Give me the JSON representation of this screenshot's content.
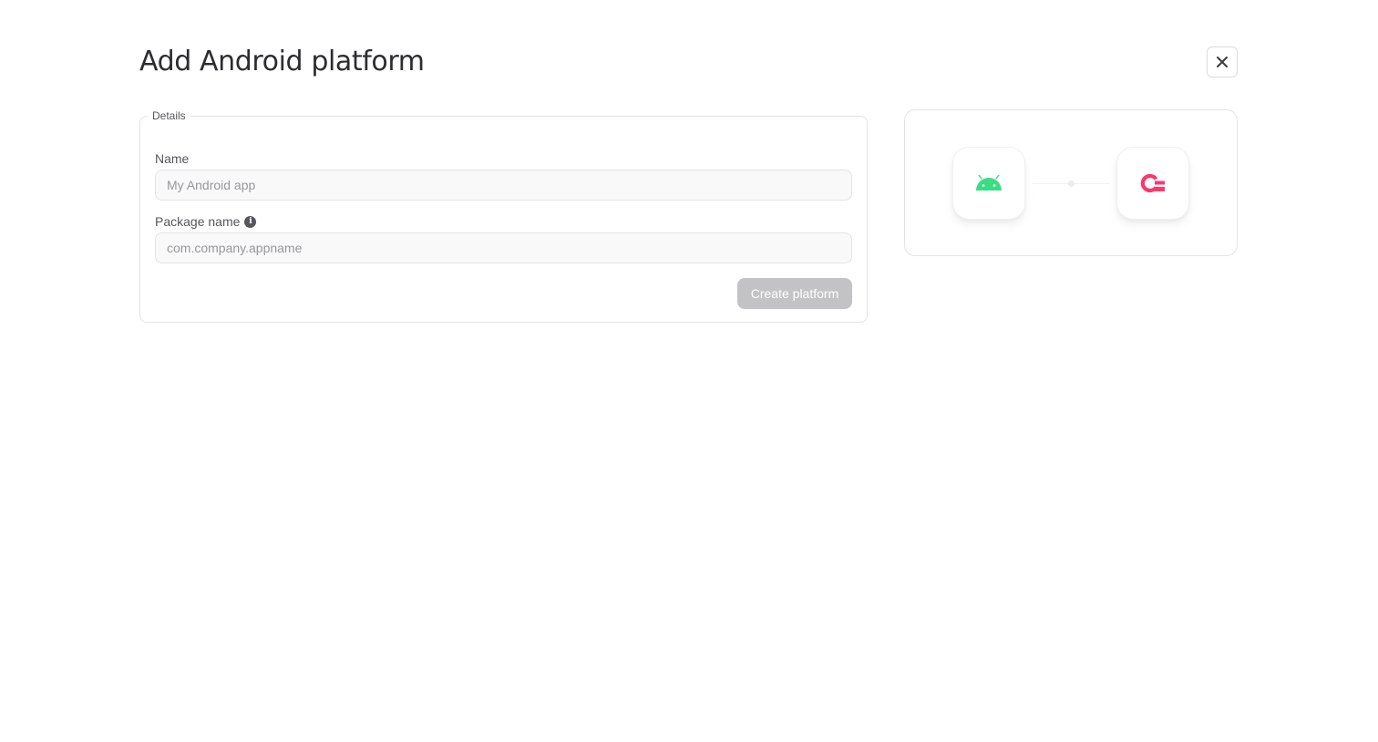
{
  "dialog": {
    "title": "Add Android platform",
    "close_icon": "close-icon"
  },
  "form": {
    "legend": "Details",
    "name_label": "Name",
    "name_placeholder": "My Android app",
    "name_value": "",
    "package_label": "Package name",
    "package_info_icon": "info-icon",
    "package_placeholder": "com.company.appname",
    "package_value": "",
    "submit_label": "Create platform",
    "submit_disabled": true
  },
  "illustration": {
    "left_icon": "android-icon",
    "right_icon": "appwrite-logo-icon",
    "colors": {
      "android_green": "#3ddc84",
      "appwrite_pink": "#fd366e"
    }
  },
  "colors": {
    "text_primary": "#2d2d31",
    "text_secondary": "#56565c",
    "border": "#e4e4e7",
    "button_disabled_bg": "#c3c3c6"
  }
}
